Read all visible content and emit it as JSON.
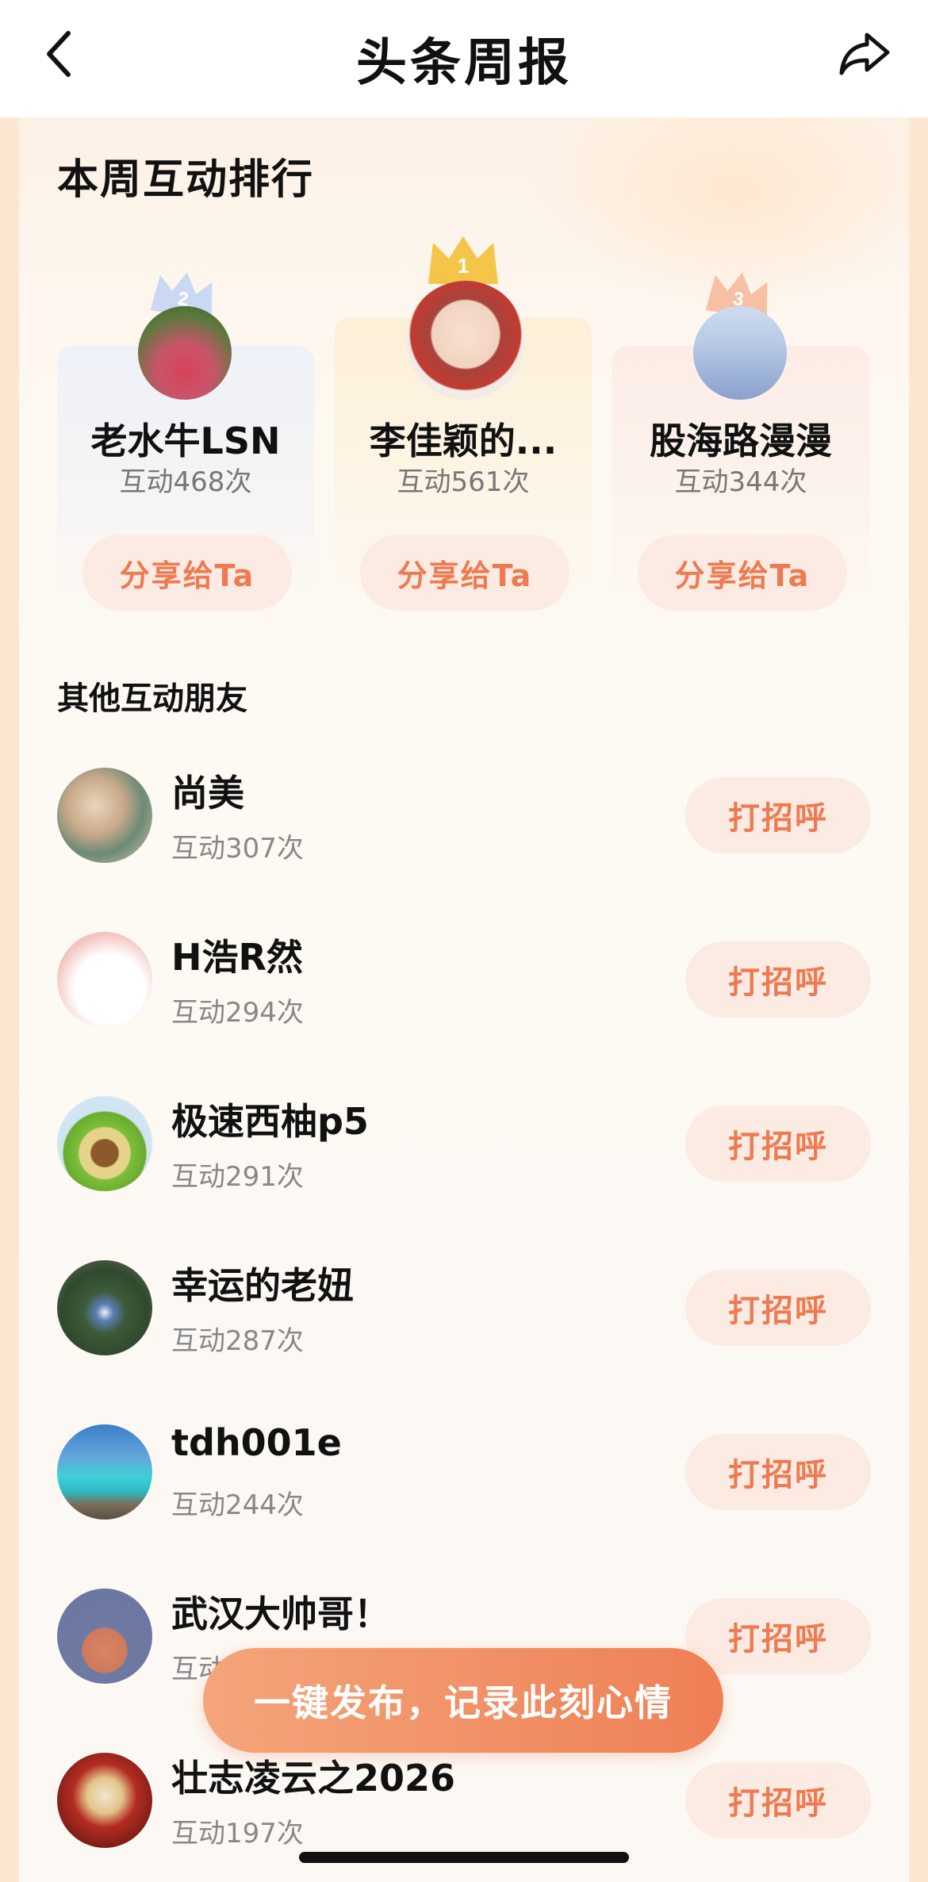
{
  "header": {
    "title": "头条周报",
    "back_icon": "chevron-left-icon",
    "share_icon": "share-arrow-icon"
  },
  "ranking": {
    "title": "本周互动排行",
    "podium": [
      {
        "rank": "2",
        "name": "老水牛LSN",
        "count": "互动468次",
        "button": "分享给Ta"
      },
      {
        "rank": "1",
        "name": "李佳颖的...",
        "count": "互动561次",
        "button": "分享给Ta"
      },
      {
        "rank": "3",
        "name": "股海路漫漫",
        "count": "互动344次",
        "button": "分享给Ta"
      }
    ]
  },
  "others": {
    "title": "其他互动朋友",
    "items": [
      {
        "name": "尚美",
        "count": "互动307次",
        "button": "打招呼"
      },
      {
        "name": "H浩R然",
        "count": "互动294次",
        "button": "打招呼"
      },
      {
        "name": "极速西柚p5",
        "count": "互动291次",
        "button": "打招呼"
      },
      {
        "name": "幸运的老妞",
        "count": "互动287次",
        "button": "打招呼"
      },
      {
        "name": "tdh001e",
        "count": "互动244次",
        "button": "打招呼"
      },
      {
        "name": "武汉大帅哥！",
        "count": "互动",
        "button": "打招呼"
      },
      {
        "name": "壮志凌云之2026",
        "count": "互动197次",
        "button": "打招呼"
      }
    ]
  },
  "cta": {
    "label": "一键发布，记录此刻心情"
  },
  "colors": {
    "accent": "#ee7a52",
    "button_bg": "#fcebe2",
    "crown_gold": "#f5c54a",
    "crown_silver": "#b9cdf0",
    "crown_bronze": "#f6b596"
  }
}
